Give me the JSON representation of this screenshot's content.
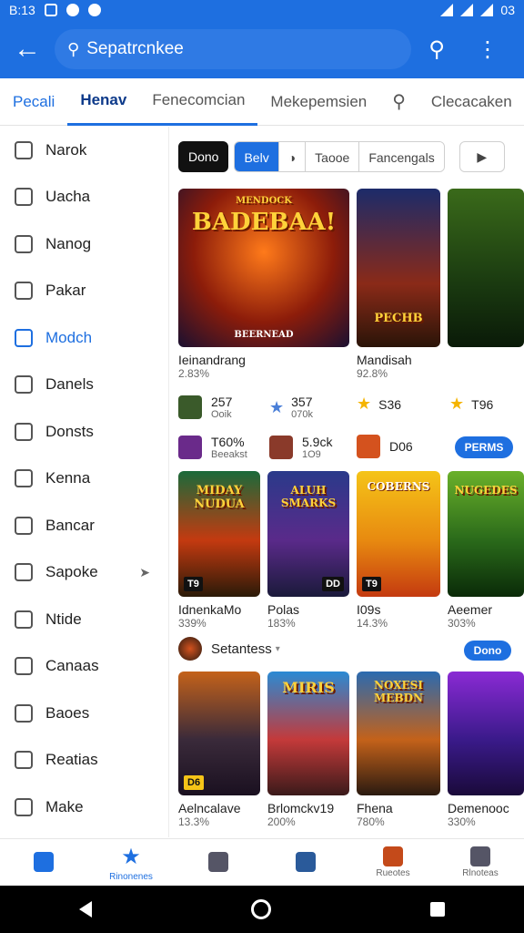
{
  "status": {
    "time": "B:13",
    "right_text": "03"
  },
  "appbar": {
    "search_text": "Sepatrcnkee"
  },
  "tabs": [
    "Pecali",
    "Henav",
    "Fenecomcian",
    "Mekepemsien",
    "Clecacaken"
  ],
  "sidebar": {
    "items": [
      {
        "label": "Narok",
        "icon": "home-icon"
      },
      {
        "label": "Uacha",
        "icon": "image-icon"
      },
      {
        "label": "Nanog",
        "icon": "people-icon"
      },
      {
        "label": "Pakar",
        "icon": "doc-icon"
      },
      {
        "label": "Modch",
        "icon": "grid-icon",
        "selected": true
      },
      {
        "label": "Danels",
        "icon": "person-icon"
      },
      {
        "label": "Donsts",
        "icon": "list-icon"
      },
      {
        "label": "Kenna",
        "icon": "calendar-icon"
      },
      {
        "label": "Bancar",
        "icon": "square-icon"
      },
      {
        "label": "Sapoke",
        "icon": "badge-icon",
        "chevron": true
      },
      {
        "label": "Ntide",
        "icon": "user-icon"
      },
      {
        "label": "Canaas",
        "icon": "chat-icon"
      },
      {
        "label": "Baoes",
        "icon": "search-person-icon"
      },
      {
        "label": "Reatias",
        "icon": "check-icon"
      },
      {
        "label": "Make",
        "icon": "gear-icon"
      }
    ]
  },
  "filters": {
    "chip1": "Dono",
    "chip2": "Belv",
    "chip4": "Taooe",
    "chip5": "Fancengals"
  },
  "row1": {
    "big1": {
      "title": "BADEBAA!",
      "sub": "MENDOCK",
      "footer": "BEERNEAD"
    },
    "big2": {
      "footer": "PECHB"
    },
    "caption1": "Ieinandrang",
    "caption1_sub": "2.83%",
    "caption2": "Mandisah",
    "caption2_sub": "92.8%"
  },
  "minis": [
    {
      "val": "257",
      "sub": "Ooik"
    },
    {
      "val": "357",
      "sub": "070k"
    },
    {
      "val": "S36"
    },
    {
      "val": "T96"
    },
    {
      "val": "T60%",
      "sub": "Beeakst"
    },
    {
      "val": "5.9ck",
      "sub": "1O9"
    },
    {
      "val": "D06"
    }
  ],
  "buttons": {
    "more1": "PERMS",
    "more2": "Dono"
  },
  "row2": [
    {
      "art": "MIDAY NUDUA",
      "caption": "IdnenkaMo",
      "sub": "339%"
    },
    {
      "art": "ALUH SMARKS",
      "caption": "Polas",
      "sub": "183%"
    },
    {
      "art": "COBERNS",
      "caption": "I09s",
      "sub": "14.3%"
    },
    {
      "art": "NUGEDES",
      "caption": "Aeemer",
      "sub": "303%"
    }
  ],
  "section": {
    "title": "Setantess"
  },
  "row3": [
    {
      "caption": "Aelncalave",
      "sub": "13.3%",
      "badge": "D6"
    },
    {
      "art": "MIRIS",
      "caption": "Brlomckv19",
      "sub": "200%"
    },
    {
      "art": "NOXESI MEBDN",
      "caption": "Fhena",
      "sub": "780%"
    },
    {
      "caption": "Demenooc",
      "sub": "330%"
    }
  ],
  "bottomnav": [
    "",
    "Rinonenes",
    "",
    "",
    "Rueotes",
    "Rlnoteas"
  ],
  "colors": {
    "accent": "#1e6fe0",
    "star": "#f5b400"
  }
}
